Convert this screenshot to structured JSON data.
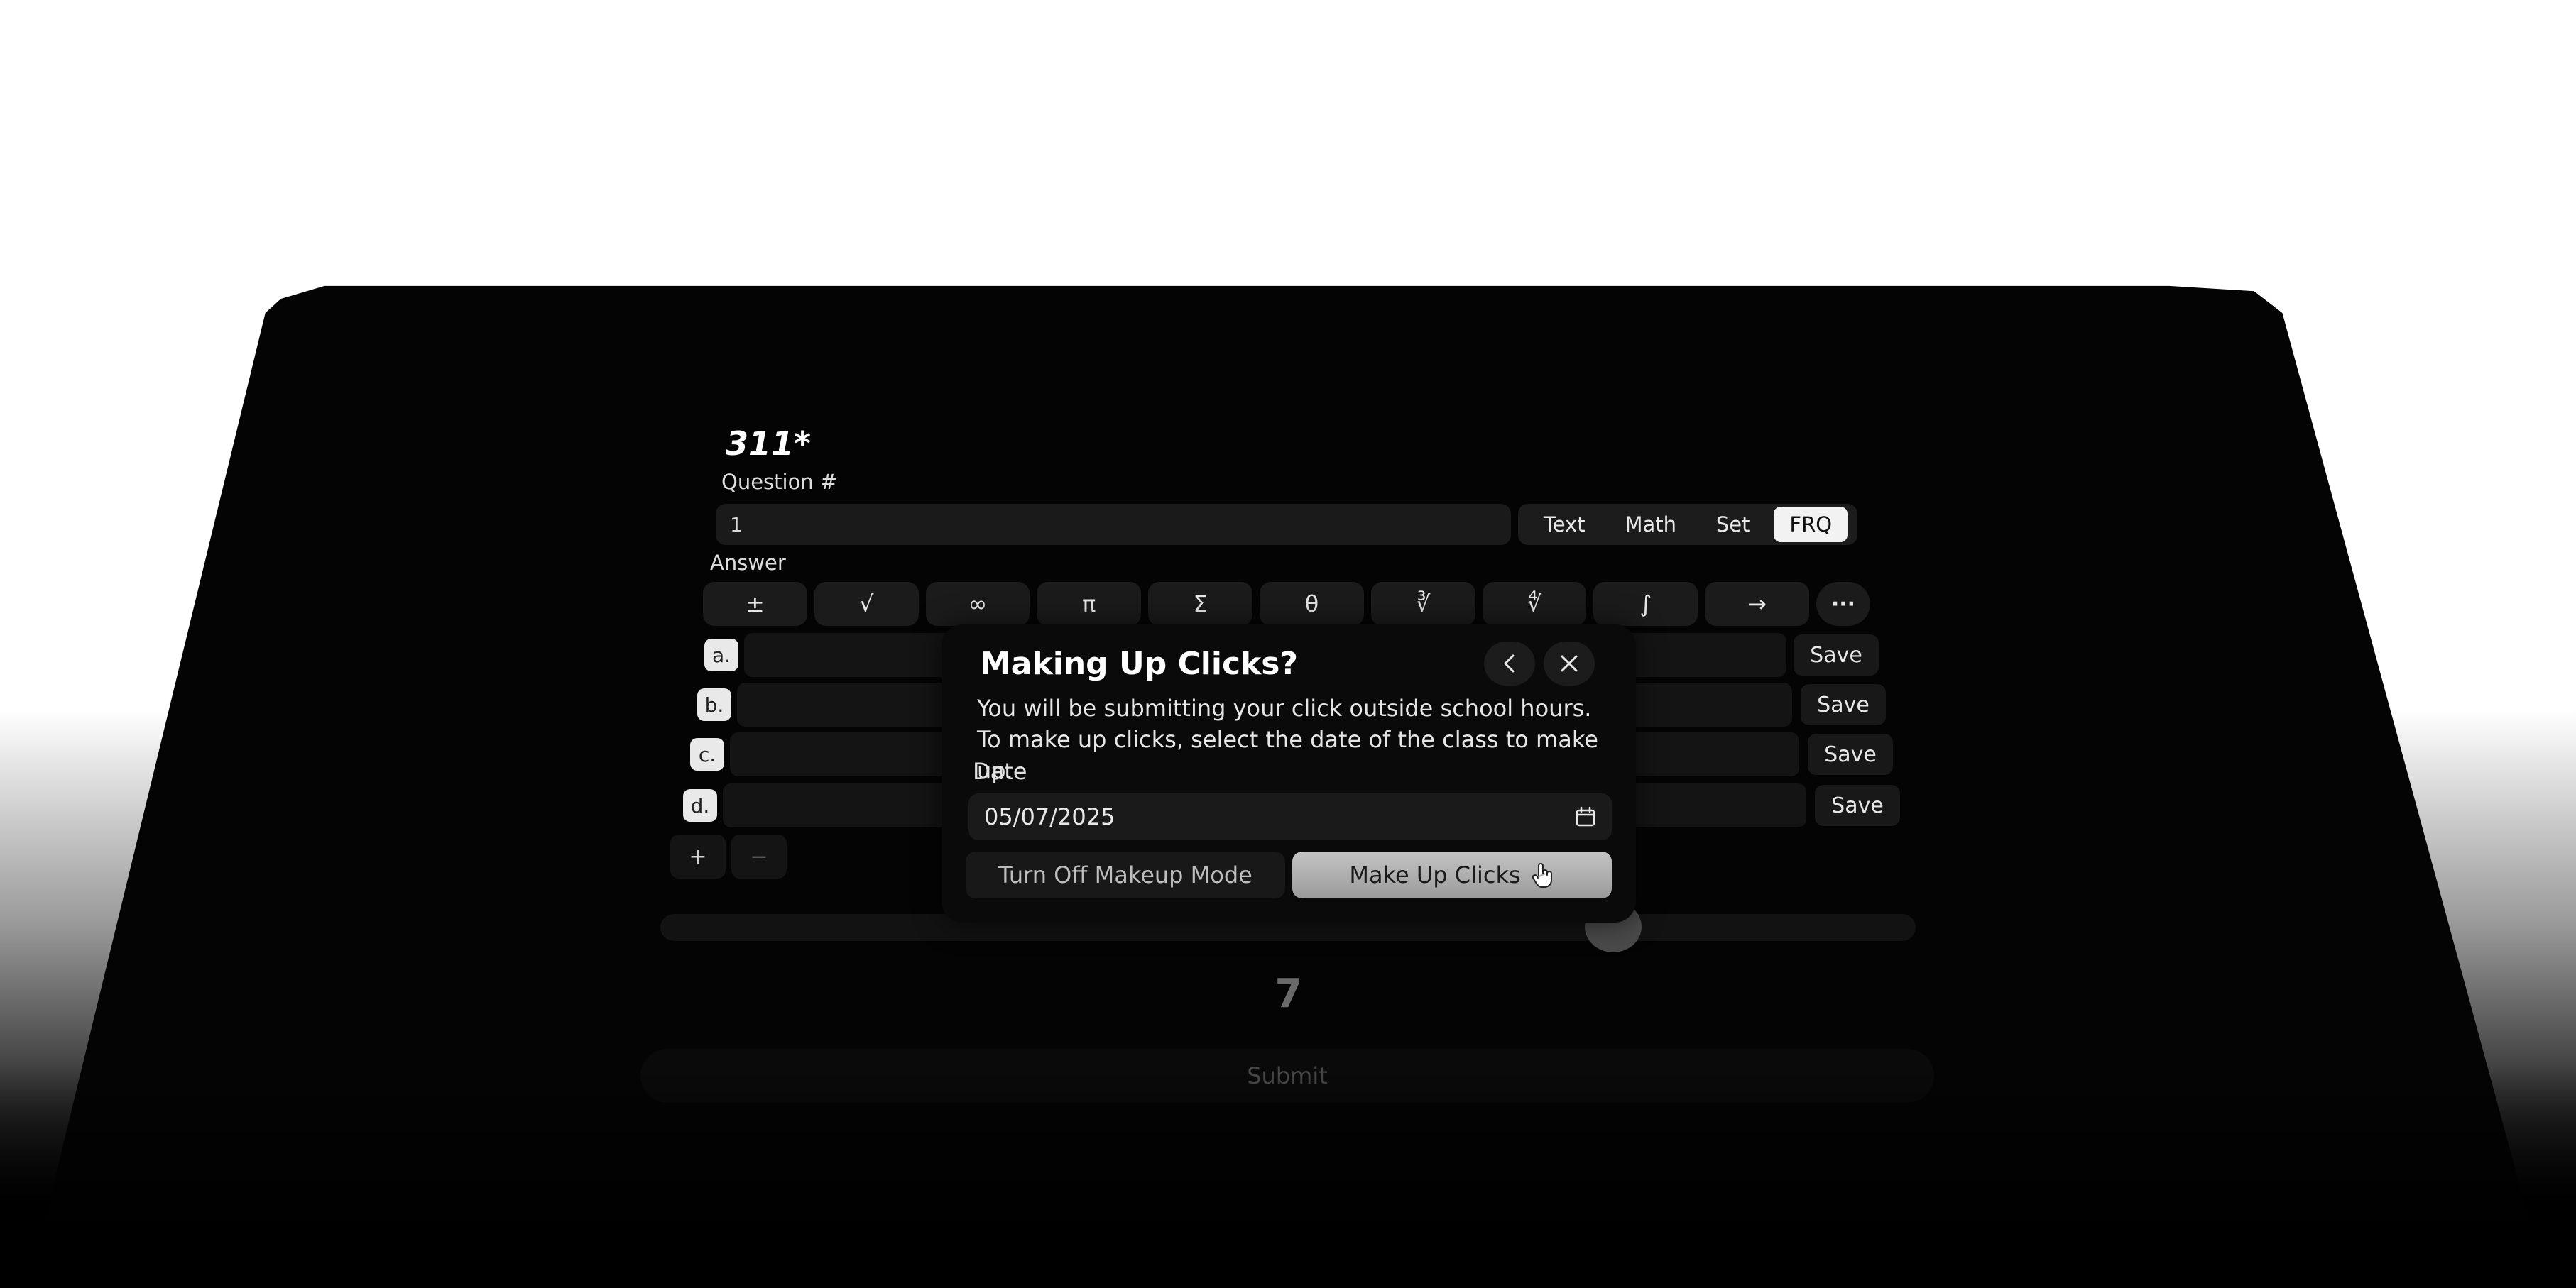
{
  "colors": {
    "background_top": "#ffffff",
    "device": "#040404",
    "surface": "#1a1a1a",
    "text": "#e8e8e8",
    "active_segment": "#f2f2f2",
    "primary_button": "#b0b0b0"
  },
  "card": {
    "title": "311*",
    "question_label": "Question #",
    "question_value": "1",
    "answer_label": "Answer"
  },
  "answer_types": [
    "Text",
    "Math",
    "Set",
    "FRQ"
  ],
  "answer_type_active": "FRQ",
  "symbols": [
    "±",
    "√",
    "∞",
    "π",
    "Σ",
    "θ",
    "∛",
    "∜",
    "∫",
    "→"
  ],
  "symbols_more": "···",
  "options": [
    {
      "label": "a.",
      "save": "Save"
    },
    {
      "label": "b.",
      "save": "Save"
    },
    {
      "label": "c.",
      "save": "Save"
    },
    {
      "label": "d.",
      "save": "Save"
    }
  ],
  "add_label": "+",
  "remove_label": "−",
  "count": "7",
  "submit_label": "Submit",
  "modal": {
    "title": "Making Up Clicks?",
    "description": "You will be submitting your click outside school hours. To make up clicks, select the date of the class to make up.",
    "date_label": "Date",
    "date_value": "05/07/2025",
    "secondary_button": "Turn Off Makeup Mode",
    "primary_button": "Make Up Clicks",
    "back_icon": "chevron-left-icon",
    "close_icon": "close-icon",
    "calendar_icon": "calendar-icon",
    "cursor_icon": "hand-pointer-icon"
  }
}
